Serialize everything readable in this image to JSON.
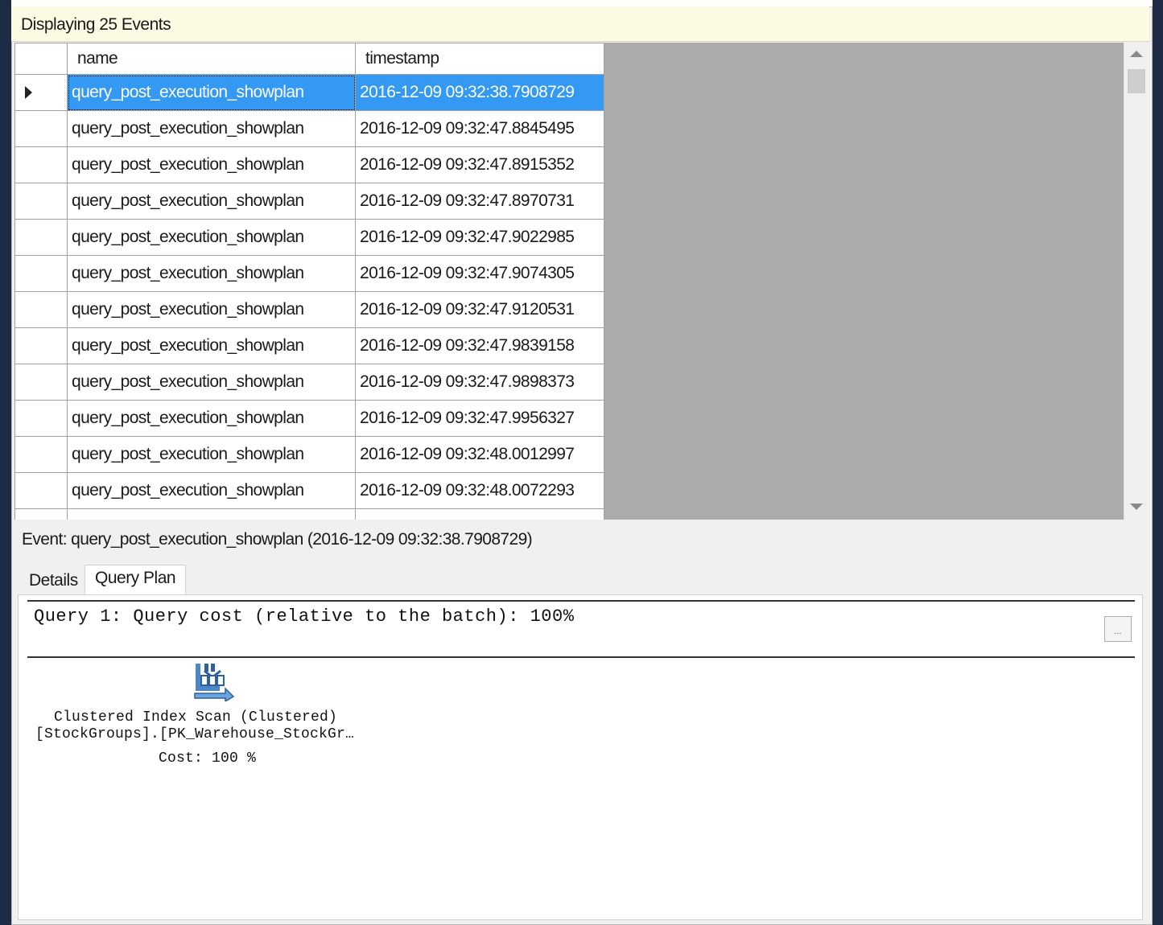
{
  "info_bar": {
    "text": "Displaying 25 Events"
  },
  "grid": {
    "columns": [
      "name",
      "timestamp"
    ],
    "rows": [
      {
        "name": "query_post_execution_showplan",
        "timestamp": "2016-12-09 09:32:38.7908729",
        "selected": true
      },
      {
        "name": "query_post_execution_showplan",
        "timestamp": "2016-12-09 09:32:47.8845495"
      },
      {
        "name": "query_post_execution_showplan",
        "timestamp": "2016-12-09 09:32:47.8915352"
      },
      {
        "name": "query_post_execution_showplan",
        "timestamp": "2016-12-09 09:32:47.8970731"
      },
      {
        "name": "query_post_execution_showplan",
        "timestamp": "2016-12-09 09:32:47.9022985"
      },
      {
        "name": "query_post_execution_showplan",
        "timestamp": "2016-12-09 09:32:47.9074305"
      },
      {
        "name": "query_post_execution_showplan",
        "timestamp": "2016-12-09 09:32:47.9120531"
      },
      {
        "name": "query_post_execution_showplan",
        "timestamp": "2016-12-09 09:32:47.9839158"
      },
      {
        "name": "query_post_execution_showplan",
        "timestamp": "2016-12-09 09:32:47.9898373"
      },
      {
        "name": "query_post_execution_showplan",
        "timestamp": "2016-12-09 09:32:47.9956327"
      },
      {
        "name": "query_post_execution_showplan",
        "timestamp": "2016-12-09 09:32:48.0012997"
      },
      {
        "name": "query_post_execution_showplan",
        "timestamp": "2016-12-09 09:32:48.0072293"
      },
      {
        "name": "",
        "timestamp": ""
      }
    ]
  },
  "event_detail": {
    "text": "Event: query_post_execution_showplan (2016-12-09 09:32:38.7908729)"
  },
  "tabs": [
    {
      "label": "Details",
      "active": false
    },
    {
      "label": "Query Plan",
      "active": true
    }
  ],
  "query_plan": {
    "header": "Query 1: Query cost (relative to the batch): 100%",
    "ellipsis_button": "...",
    "operator": {
      "icon": "clustered-index-scan-icon",
      "line1": "Clustered Index Scan (Clustered)",
      "line2": "[StockGroups].[PK_Warehouse_StockGr…",
      "line3": "Cost: 100 %"
    }
  },
  "colors": {
    "selection": "#3399f3",
    "info_bar": "#fbfbe4",
    "grid_empty": "#ababab",
    "frame": "#1f2a44"
  }
}
